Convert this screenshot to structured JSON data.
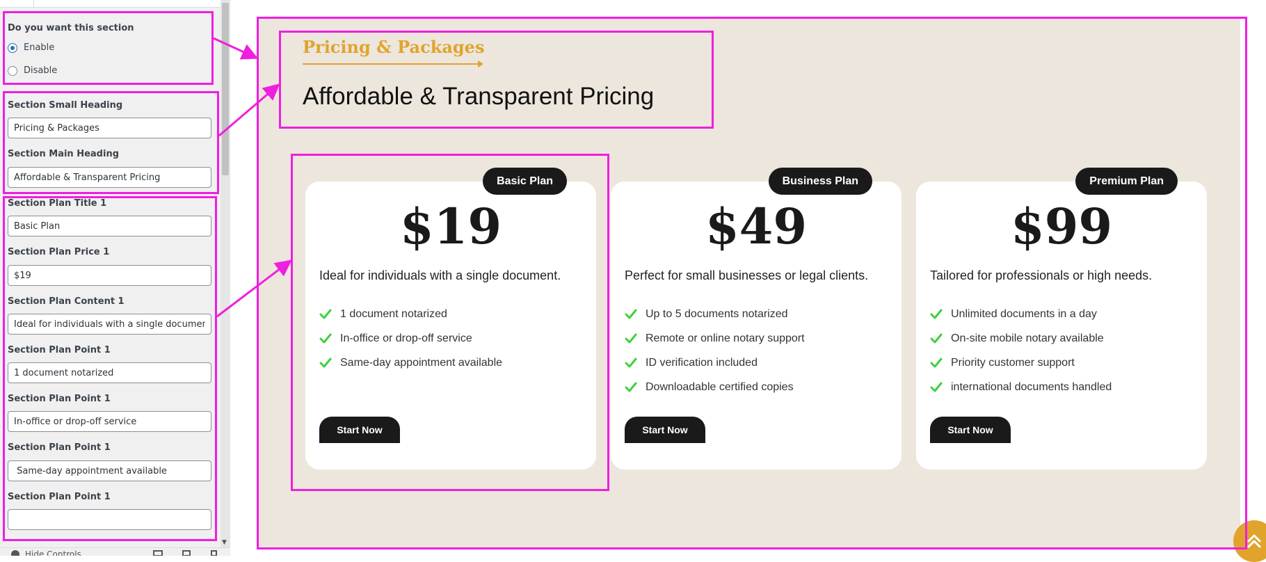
{
  "panel": {
    "section_toggle": {
      "label": "Do you want this section",
      "options": [
        {
          "label": "Enable",
          "checked": true
        },
        {
          "label": "Disable",
          "checked": false
        }
      ]
    },
    "fields": [
      {
        "label": "Section Small Heading",
        "value": "Pricing & Packages"
      },
      {
        "label": "Section Main Heading",
        "value": "Affordable & Transparent Pricing"
      },
      {
        "label": "Section Plan Title 1",
        "value": "Basic Plan"
      },
      {
        "label": "Section Plan Price 1",
        "value": "$19"
      },
      {
        "label": "Section Plan Content 1",
        "value": "Ideal for individuals with a single document"
      },
      {
        "label": "Section Plan Point 1",
        "value": "1 document notarized"
      },
      {
        "label": "Section Plan Point 1",
        "value": "In-office or drop-off service"
      },
      {
        "label": "Section Plan Point 1",
        "value": " Same-day appointment available"
      },
      {
        "label": "Section Plan Point 1",
        "value": ""
      }
    ],
    "footer": {
      "hide_controls": "Hide Controls"
    }
  },
  "preview": {
    "small_heading": "Pricing & Packages",
    "main_heading": "Affordable & Transparent Pricing",
    "plans": [
      {
        "title": "Basic Plan",
        "price": "$19",
        "description": "Ideal for individuals with a single document.",
        "points": [
          "1 document notarized",
          "In-office or drop-off service",
          "Same-day appointment available"
        ],
        "button": "Start Now"
      },
      {
        "title": "Business Plan",
        "price": "$49",
        "description": "Perfect for small businesses or legal clients.",
        "points": [
          "Up to 5 documents notarized",
          "Remote or online notary support",
          "ID verification included",
          "Downloadable certified copies"
        ],
        "button": "Start Now"
      },
      {
        "title": "Premium Plan",
        "price": "$99",
        "description": "Tailored for professionals or high needs.",
        "points": [
          "Unlimited documents in a day",
          "On-site mobile notary available",
          "Priority customer support",
          "international documents handled"
        ],
        "button": "Start Now"
      }
    ]
  },
  "colors": {
    "accent": "#e0a42d",
    "section_bg": "#ede6dc",
    "annotation": "#f01ee0",
    "check": "#3fd03f",
    "dark": "#1a1a1a"
  },
  "icons": {
    "check": "check-icon",
    "scroll_top": "double-chevron-up-icon"
  }
}
